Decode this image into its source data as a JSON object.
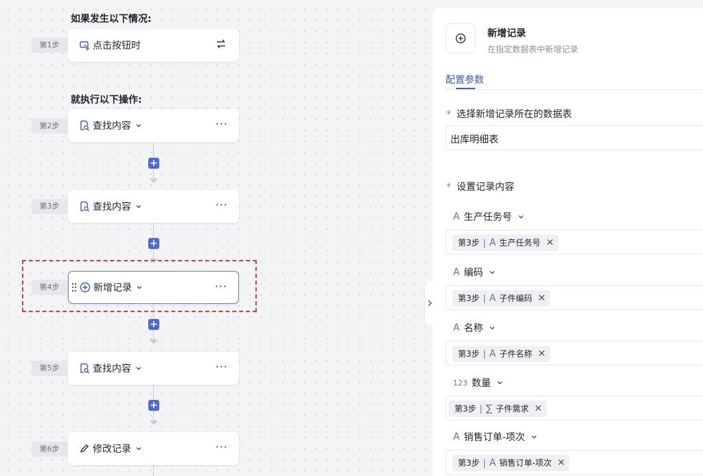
{
  "flow": {
    "trigger_title": "如果发生以下情况:",
    "actions_title": "就执行以下操作:",
    "steps": [
      {
        "tag": "第1步",
        "label": "点击按钮时",
        "icon": "cursor-click-icon"
      },
      {
        "tag": "第2步",
        "label": "查找内容",
        "icon": "search-doc-icon"
      },
      {
        "tag": "第3步",
        "label": "查找内容",
        "icon": "search-doc-icon"
      },
      {
        "tag": "第4步",
        "label": "新增记录",
        "icon": "plus-circle-icon",
        "active": true
      },
      {
        "tag": "第5步",
        "label": "查找内容",
        "icon": "search-doc-icon"
      },
      {
        "tag": "第6步",
        "label": "修改记录",
        "icon": "pencil-icon"
      }
    ],
    "more_glyph": "···",
    "plus_glyph": "+"
  },
  "panel": {
    "title": "新增记录",
    "subtitle": "在指定数据表中新增记录",
    "tab": "配置参数",
    "table_label": "选择新增记录所在的数据表",
    "table_value": "出库明细表",
    "content_label": "设置记录内容",
    "required_mark": "*",
    "fields": [
      {
        "type": "A",
        "name": "生产任务号",
        "chip_step": "第3步",
        "chip_type": "A",
        "chip_value": "生产任务号"
      },
      {
        "type": "A",
        "name": "编码",
        "chip_step": "第3步",
        "chip_type": "A",
        "chip_value": "子件编码"
      },
      {
        "type": "A",
        "name": "名称",
        "chip_step": "第3步",
        "chip_type": "A",
        "chip_value": "子件名称"
      },
      {
        "type": "123",
        "name": "数量",
        "chip_step": "第3步",
        "chip_type": "∑",
        "chip_value": "子件需求"
      },
      {
        "type": "A",
        "name": "销售订单-项次",
        "chip_step": "第3步",
        "chip_type": "A",
        "chip_value": "销售订单-项次"
      }
    ],
    "chip_close": "✕"
  },
  "colors": {
    "accent": "#4a69dd",
    "tab_accent": "#3a5bd0",
    "required": "#e07b2a",
    "highlight_dash": "#e5393b"
  }
}
